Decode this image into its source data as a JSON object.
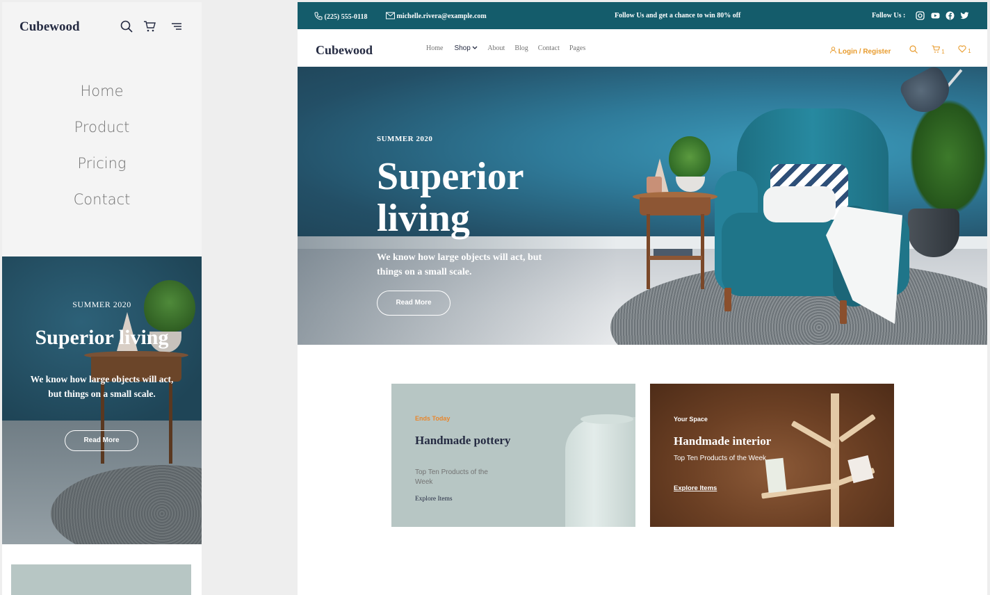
{
  "mobile": {
    "logo": "Cubewood",
    "nav": [
      "Home",
      "Product",
      "Pricing",
      "Contact"
    ],
    "hero": {
      "season": "SUMMER 2020",
      "title": "Superior living",
      "description": "We know how large objects will act, but things on a small scale.",
      "button": "Read More"
    }
  },
  "desktop": {
    "topbar": {
      "phone": "(225) 555-0118",
      "email": "michelle.rivera@example.com",
      "promo": "Follow Us  and get a chance to win 80% off",
      "follow_label": "Follow Us :"
    },
    "navbar": {
      "logo": "Cubewood",
      "links": [
        "Home",
        "Shop",
        "About",
        "Blog",
        "Contact",
        "Pages"
      ],
      "login": "Login / Register",
      "cart_count": "1",
      "wishlist_count": "1"
    },
    "hero": {
      "season": "SUMMER 2020",
      "title": "Superior living",
      "description": "We know how large objects will act, but things on a small scale.",
      "button": "Read More"
    },
    "promos": [
      {
        "kicker": "Ends Today",
        "title": "Handmade pottery",
        "subtitle": "Top Ten Products  of the Week",
        "link": "Explore Items"
      },
      {
        "kicker": "Your Space",
        "title": "Handmade interior",
        "subtitle": "Top Ten Products  of the Week",
        "link": "Explore Items"
      }
    ]
  },
  "colors": {
    "topbar": "#145c6b",
    "accent": "#e89b2c",
    "heading": "#252b42",
    "promo_sage": "#b7c6c4",
    "promo_brown": "#6c4024"
  },
  "icons": [
    "search-icon",
    "cart-icon",
    "menu-icon",
    "phone-icon",
    "mail-icon",
    "instagram-icon",
    "youtube-icon",
    "facebook-icon",
    "twitter-icon",
    "user-icon",
    "heart-icon",
    "chevron-down-icon"
  ]
}
